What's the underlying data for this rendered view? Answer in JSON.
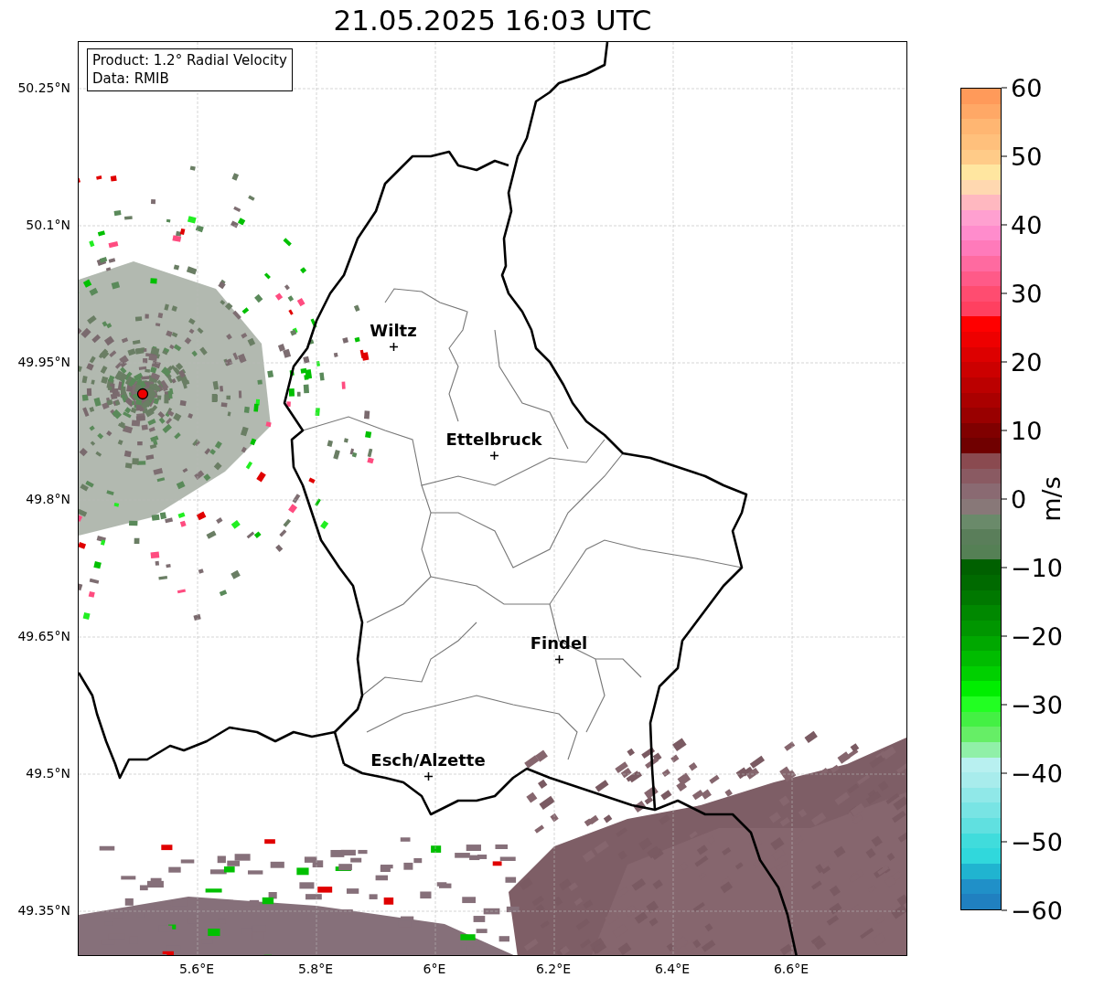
{
  "title": "21.05.2025 16:03 UTC",
  "info_box": {
    "lines": [
      "Product: 1.2° Radial Velocity",
      "Data: RMIB"
    ]
  },
  "cities": [
    {
      "name": "Wiltz"
    },
    {
      "name": "Ettelbruck"
    },
    {
      "name": "Findel"
    },
    {
      "name": "Esch/Alzette"
    }
  ],
  "y_ticks": [
    "50.25°N",
    "50.1°N",
    "49.95°N",
    "49.8°N",
    "49.65°N",
    "49.5°N",
    "49.35°N"
  ],
  "x_ticks": [
    "5.6°E",
    "5.8°E",
    "6°E",
    "6.2°E",
    "6.4°E",
    "6.6°E"
  ],
  "colorbar": {
    "label": "m/s",
    "ticks": [
      "60",
      "50",
      "40",
      "30",
      "20",
      "10",
      "0",
      "−10",
      "−20",
      "−30",
      "−40",
      "−50",
      "−60"
    ]
  }
}
